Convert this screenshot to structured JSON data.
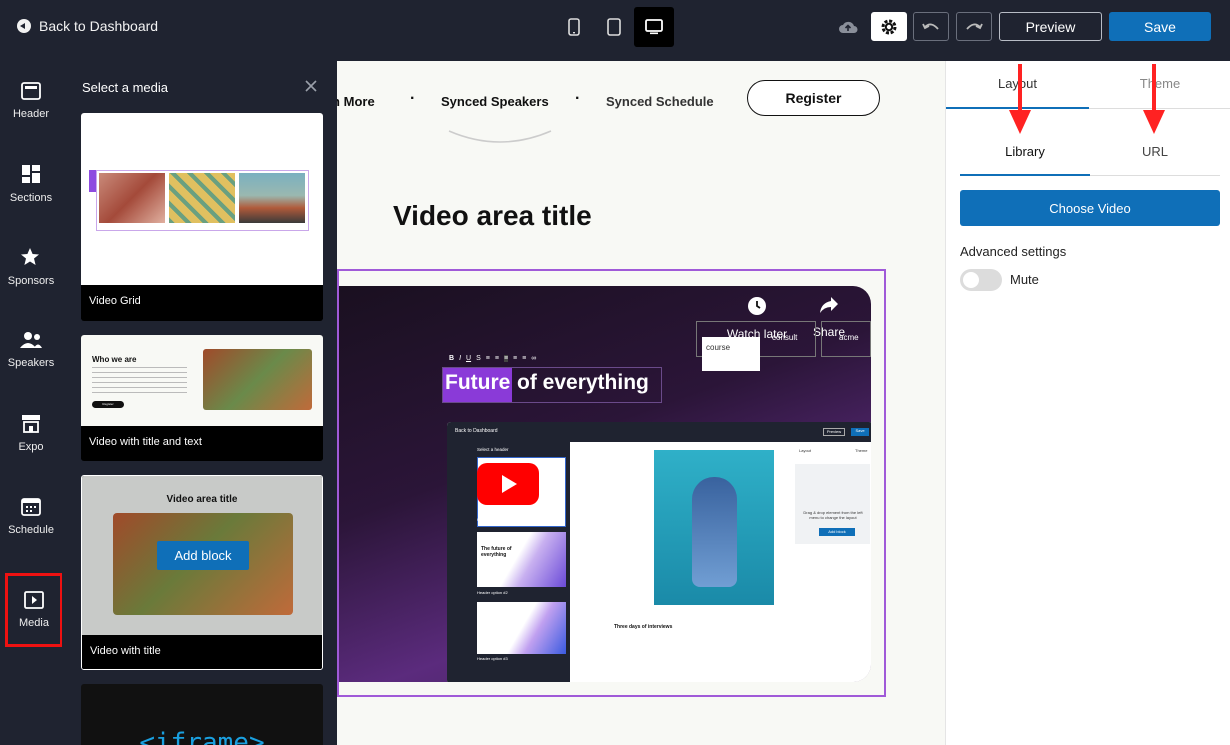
{
  "topbar": {
    "back_label": "Back to Dashboard",
    "devices": [
      "mobile-icon",
      "tablet-icon",
      "desktop-icon"
    ],
    "preview_label": "Preview",
    "save_label": "Save"
  },
  "rail": {
    "items": [
      {
        "label": "Header",
        "icon": "header-icon"
      },
      {
        "label": "Sections",
        "icon": "sections-icon"
      },
      {
        "label": "Sponsors",
        "icon": "sponsors-icon"
      },
      {
        "label": "Speakers",
        "icon": "speakers-icon"
      },
      {
        "label": "Expo",
        "icon": "expo-icon"
      },
      {
        "label": "Schedule",
        "icon": "schedule-icon"
      },
      {
        "label": "Media",
        "icon": "media-icon"
      }
    ]
  },
  "media_panel": {
    "title": "Select a media",
    "cards": [
      {
        "caption": "Video Grid"
      },
      {
        "caption": "Video with title and text",
        "thumb_heading": "Who we are",
        "thumb_button": "Register"
      },
      {
        "caption": "Video with title",
        "thumb_heading": "Video area title",
        "thumb_button": "Add block"
      },
      {
        "thumb_text": "<iframe>"
      }
    ]
  },
  "canvas": {
    "nav": [
      "rn More",
      "Synced Speakers",
      "Synced Schedule"
    ],
    "register_label": "Register",
    "video_title": "Video area title",
    "video": {
      "watch_later": "Watch later",
      "share": "Share",
      "headline_highlight": "Future",
      "headline_rest": "of everything",
      "logos": [
        "course",
        "consult",
        "acme"
      ],
      "inner_back": "Back to Dashboard",
      "inner_panel_title": "Select a header",
      "inner_preview": "Preview",
      "inner_save": "Save",
      "inner_rail": [
        "Header",
        "Sections",
        "Speakers",
        "Schedule",
        "Sponsors",
        "Expo",
        "Media"
      ],
      "inner_cards": [
        "Header option #1",
        "Header option #2",
        "Header option #3"
      ],
      "inner_card_heading": "The future of everything",
      "inner_tabs": [
        "Layout",
        "Theme"
      ],
      "inner_drag_text": "Drag & drop element from the left menu to change the layout",
      "inner_add_block": "Add block",
      "inner_section_title": "Three days of interviews"
    }
  },
  "props": {
    "tabs": [
      "Layout",
      "Theme"
    ],
    "subtabs": [
      "Library",
      "URL"
    ],
    "choose_label": "Choose Video",
    "advanced_label": "Advanced settings",
    "mute_label": "Mute",
    "mute_on": false
  },
  "colors": {
    "accent": "#0f6fb8",
    "dark": "#1f2330",
    "highlight": "#a05ad8",
    "annotation": "#ff2222"
  }
}
